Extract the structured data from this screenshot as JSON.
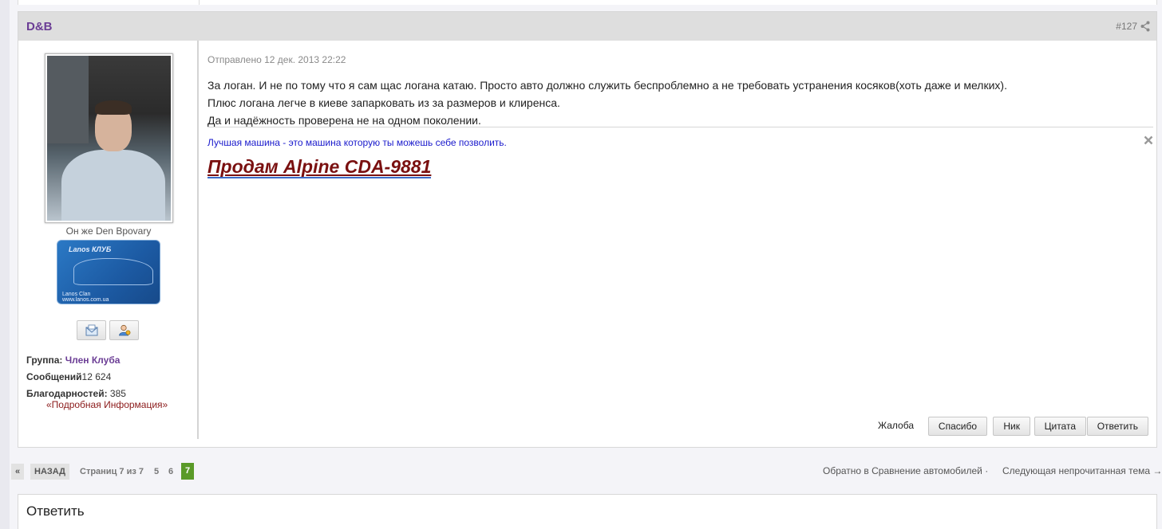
{
  "post": {
    "author": "D&B",
    "number": "#127",
    "posted": "Отправлено 12 дек. 2013 22:22",
    "message_lines": [
      "За логан. И не по тому что я сам щас логана катаю. Просто авто должно служить беспроблемно а не требовать устранения косяков(хоть даже и мелких).",
      "Плюс логана легче в киеве запарковать из за размеров и клиренса.",
      "Да и надёжность проверена не на одном поколении."
    ],
    "signature_text": "Лучшая машина - это машина которую ты можешь себе позволить.",
    "signature_link": "Продам Alpine CDA-9881"
  },
  "author_info": {
    "user_title": "Он же Den Bpovary",
    "club_card": {
      "brand": "Lanos КЛУБ",
      "line1": "Lanos Clan",
      "line2": "www.lanos.com.ua"
    },
    "group_label": "Группа:",
    "group_value": "Член Клуба",
    "posts_label": "Сообщений",
    "posts_value": "12 624",
    "thanks_label": "Благодарностей:",
    "thanks_value": "385",
    "more_link": "«Подробная Информация»"
  },
  "actions": {
    "complaint": "Жалоба",
    "thanks": "Спасибо",
    "nick": "Ник",
    "quote": "Цитата",
    "reply": "Ответить"
  },
  "pager": {
    "first": "«",
    "back": "НАЗАД",
    "info": "Страниц 7 из 7",
    "pages": [
      "5",
      "6"
    ],
    "current": "7"
  },
  "nav": {
    "back_to": "Обратно в Сравнение автомобилей ·",
    "next_unread": "Следующая непрочитанная тема →"
  },
  "reply_box": {
    "title": "Ответить"
  },
  "colors": {
    "author": "#6b3d95",
    "current_page": "#5a9a28",
    "signature_link": "#7a1010"
  }
}
